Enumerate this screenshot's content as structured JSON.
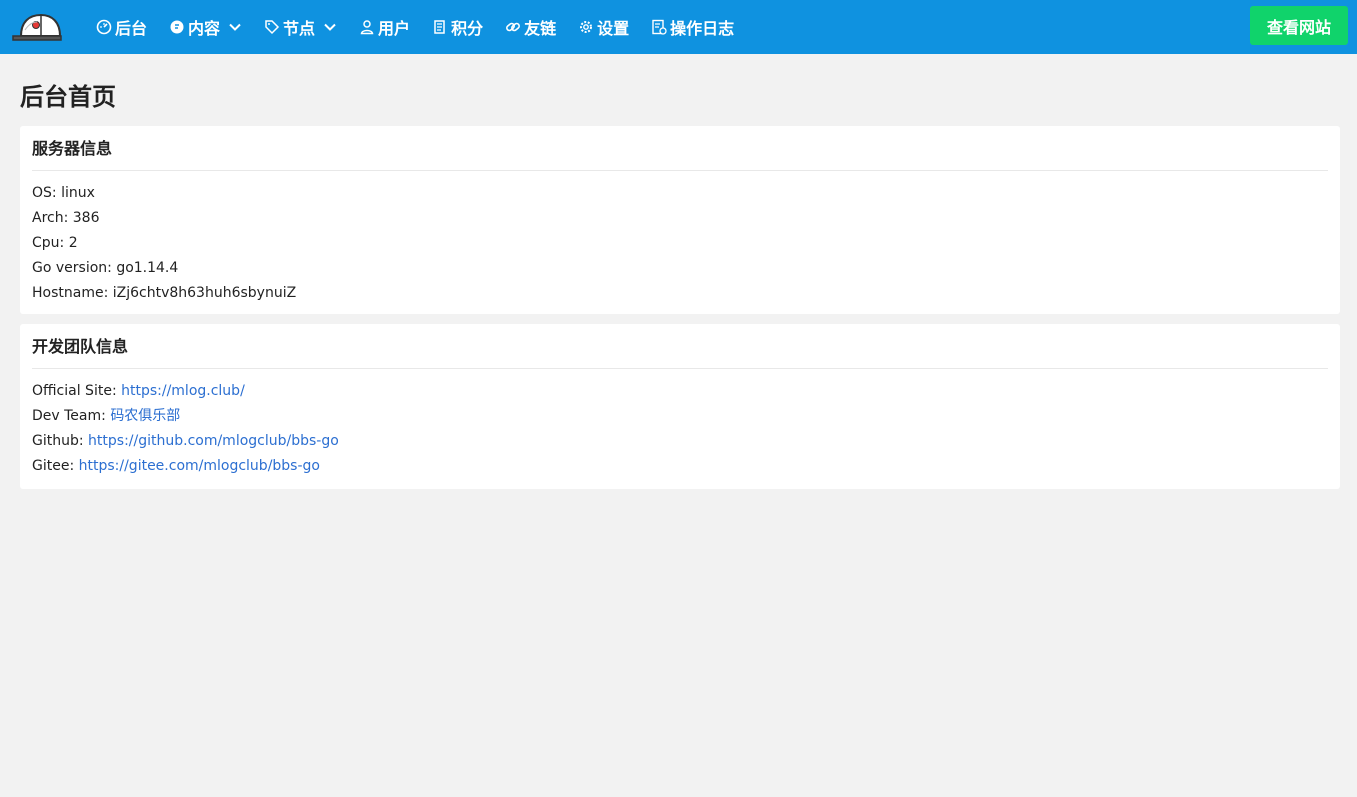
{
  "nav": {
    "items": [
      {
        "label": "后台",
        "icon": "dashboard-icon"
      },
      {
        "label": "内容",
        "icon": "chat-icon",
        "dropdown": true
      },
      {
        "label": "节点",
        "icon": "tag-icon",
        "dropdown": true
      },
      {
        "label": "用户",
        "icon": "user-icon"
      },
      {
        "label": "积分",
        "icon": "document-icon"
      },
      {
        "label": "友链",
        "icon": "link-icon"
      },
      {
        "label": "设置",
        "icon": "gear-icon"
      },
      {
        "label": "操作日志",
        "icon": "log-icon"
      }
    ],
    "view_site_label": "查看网站"
  },
  "colors": {
    "navbar": "#0f92e0",
    "button": "#10d36b",
    "link": "#2c6fd1"
  },
  "page": {
    "title": "后台首页"
  },
  "server_card": {
    "title": "服务器信息",
    "rows": [
      {
        "label": "OS:",
        "value": "linux"
      },
      {
        "label": "Arch:",
        "value": "386"
      },
      {
        "label": "Cpu:",
        "value": "2"
      },
      {
        "label": "Go version:",
        "value": "go1.14.4"
      },
      {
        "label": "Hostname:",
        "value": "iZj6chtv8h63huh6sbynuiZ"
      }
    ]
  },
  "team_card": {
    "title": "开发团队信息",
    "rows": [
      {
        "label": "Official Site:",
        "link": "https://mlog.club/"
      },
      {
        "label": "Dev Team:",
        "link": "码农俱乐部"
      },
      {
        "label": "Github:",
        "link": "https://github.com/mlogclub/bbs-go"
      },
      {
        "label": "Gitee:",
        "link": "https://gitee.com/mlogclub/bbs-go"
      }
    ]
  }
}
